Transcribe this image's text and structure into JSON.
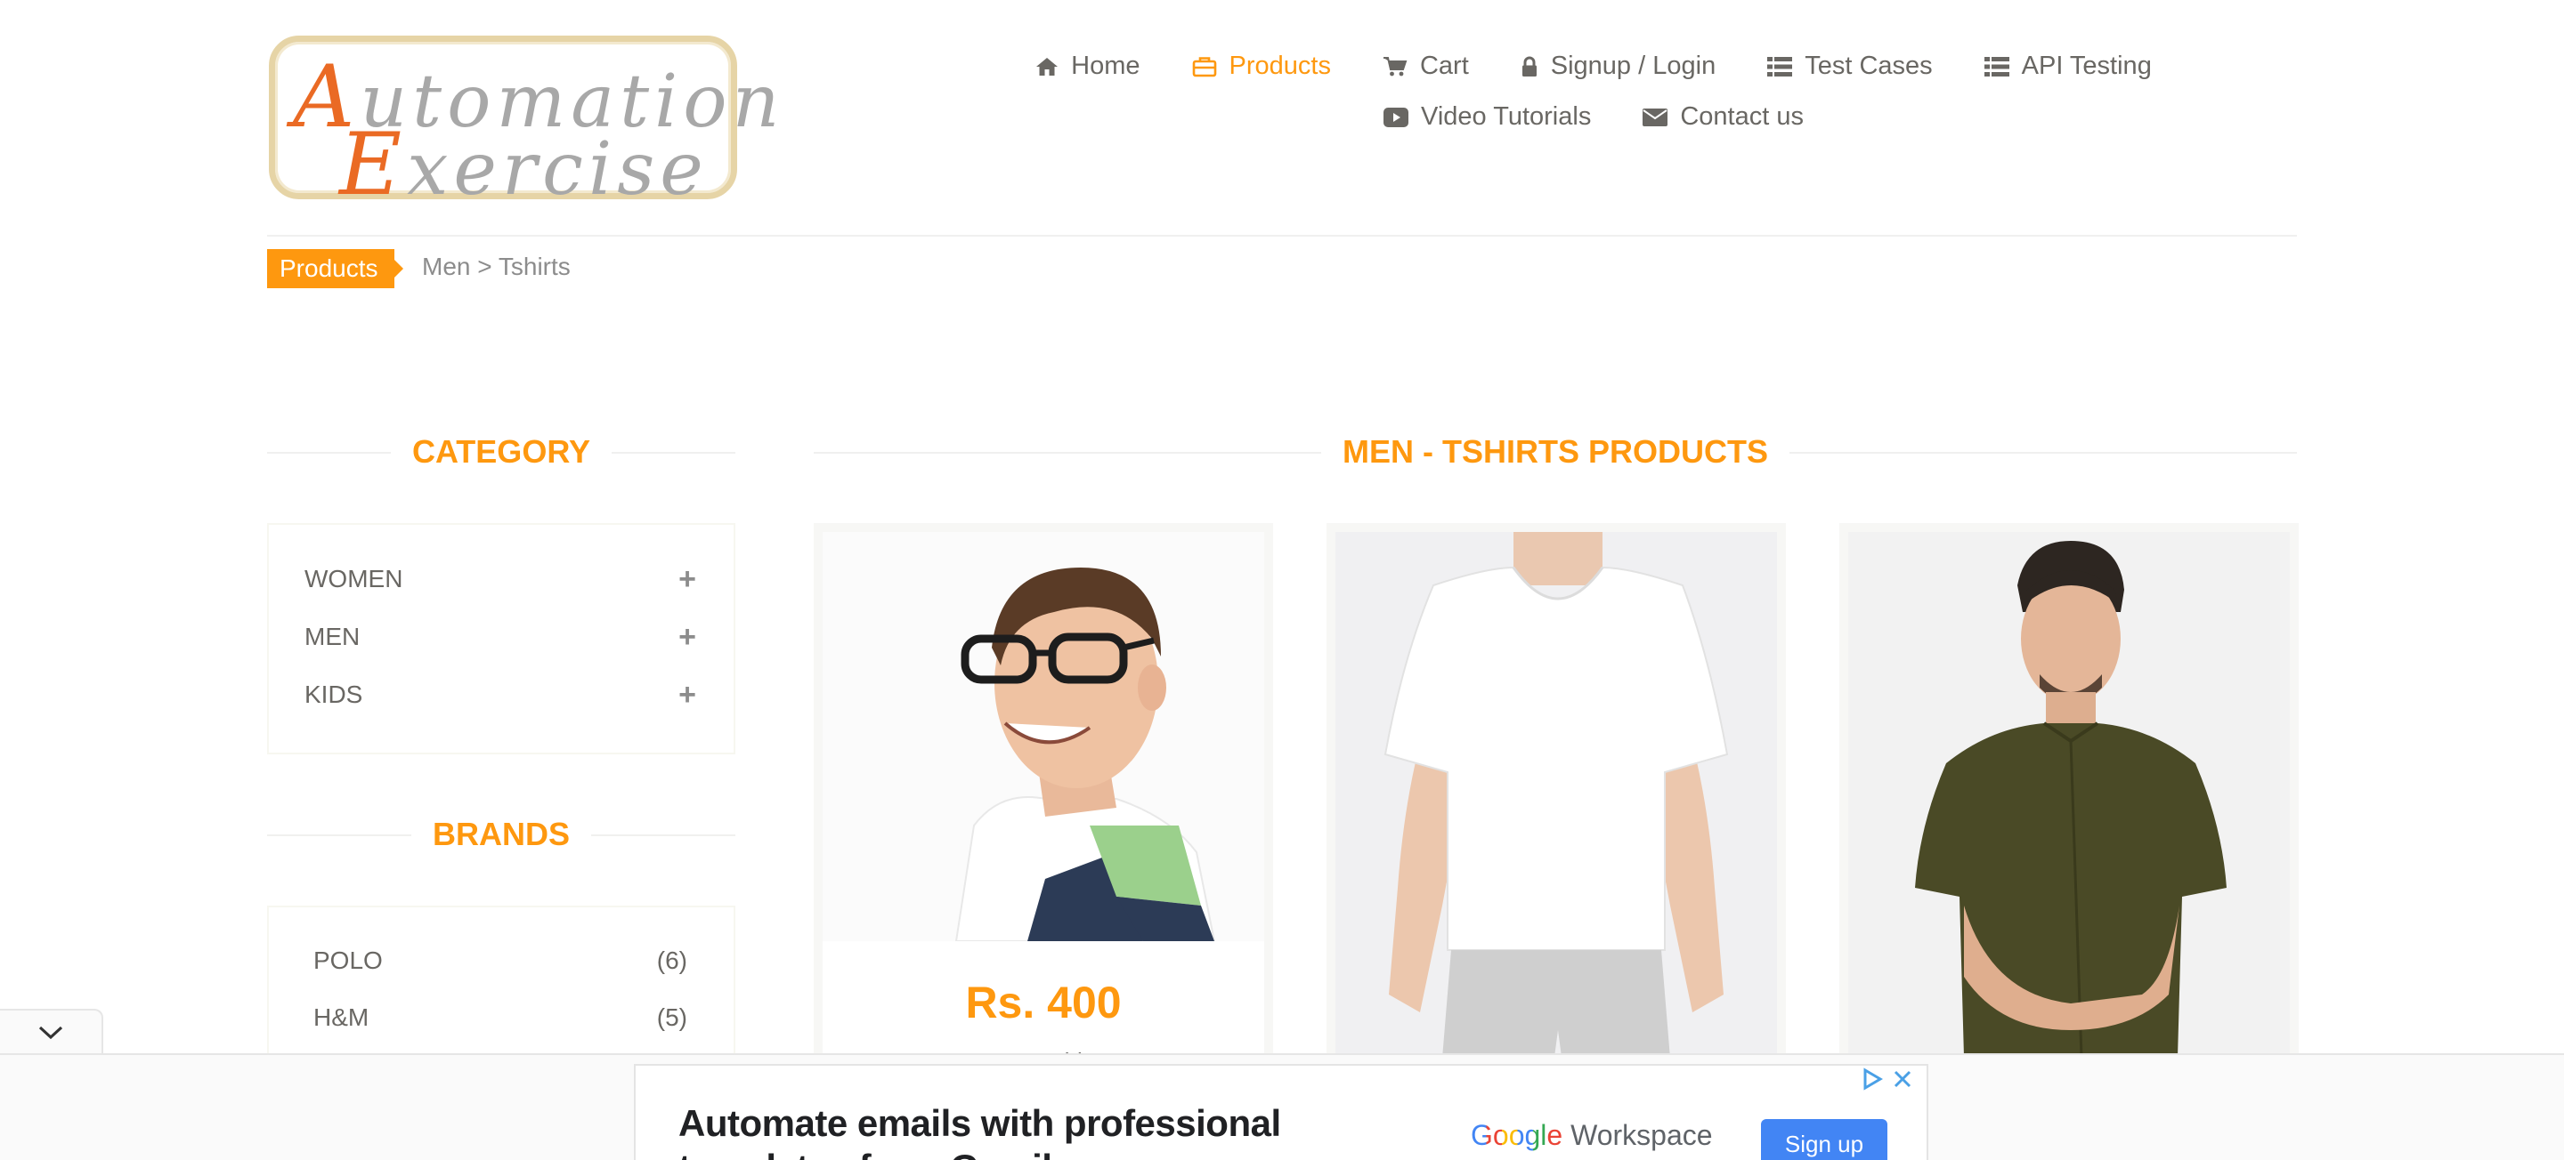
{
  "header": {
    "logo": {
      "line1_cap": "A",
      "line1_rest": "utomation",
      "line2_cap": "E",
      "line2_rest": "xercise"
    },
    "nav": [
      {
        "label": "Home",
        "icon": "home-icon"
      },
      {
        "label": "Products",
        "icon": "briefcase-icon",
        "active": true
      },
      {
        "label": "Cart",
        "icon": "cart-icon"
      },
      {
        "label": "Signup / Login",
        "icon": "lock-icon"
      },
      {
        "label": "Test Cases",
        "icon": "list-icon"
      },
      {
        "label": "API Testing",
        "icon": "list-icon"
      },
      {
        "label": "Video Tutorials",
        "icon": "youtube-play-icon"
      },
      {
        "label": "Contact us",
        "icon": "envelope-icon"
      }
    ]
  },
  "breadcrumb": {
    "tag": "Products",
    "path": "Men > Tshirts"
  },
  "sidebar": {
    "category_title": "CATEGORY",
    "categories": [
      {
        "label": "WOMEN",
        "toggle": "+"
      },
      {
        "label": "MEN",
        "toggle": "+"
      },
      {
        "label": "KIDS",
        "toggle": "+"
      }
    ],
    "brands_title": "BRANDS",
    "brands": [
      {
        "name": "POLO",
        "count": "(6)"
      },
      {
        "name": "H&M",
        "count": "(5)"
      }
    ]
  },
  "main": {
    "title": "MEN - TSHIRTS PRODUCTS",
    "products": [
      {
        "price": "Rs. 400",
        "name": "Men Tshirt"
      },
      {
        "price": "",
        "name": ""
      },
      {
        "price": "",
        "name": ""
      }
    ]
  },
  "ad": {
    "headline": "Automate emails with professional templates from Gmail",
    "brand_google": "Google",
    "brand_product": "Workspace",
    "cta": "Sign up"
  },
  "colors": {
    "accent": "#fe980f",
    "text": "#696763",
    "ad_button": "#4285f4"
  }
}
